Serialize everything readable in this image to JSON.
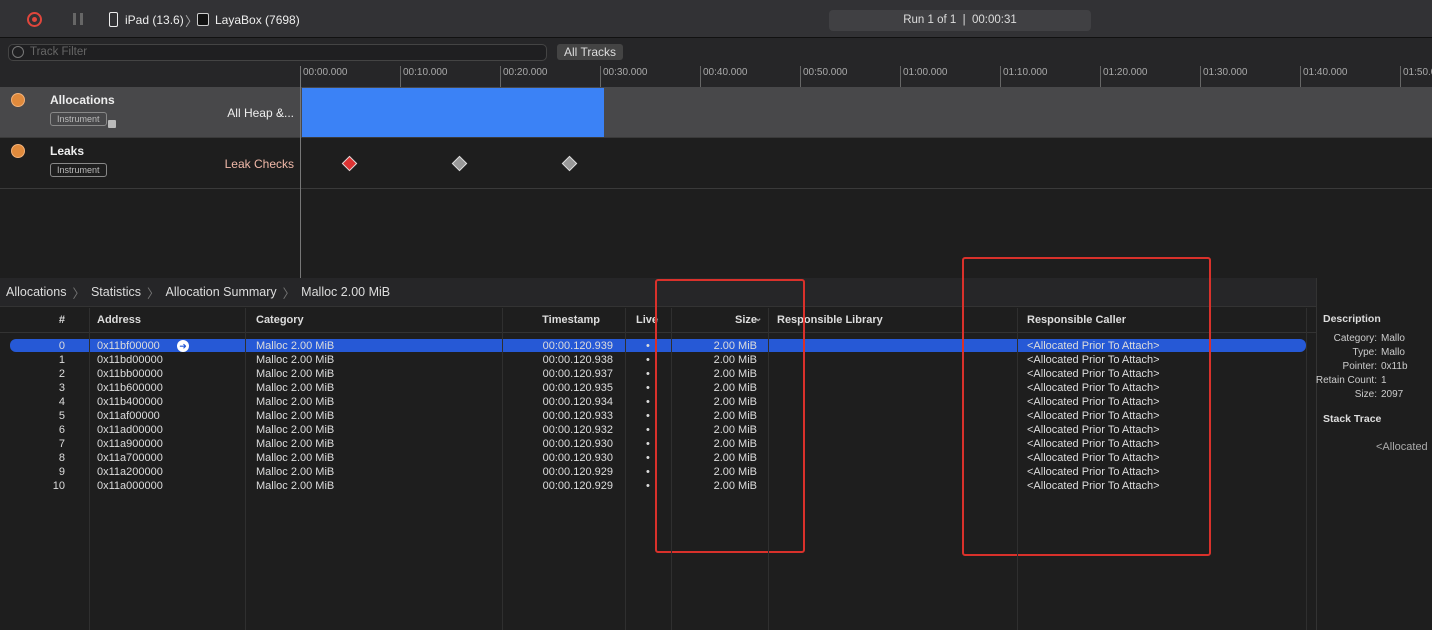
{
  "toolbar": {
    "device": "iPad (13.6)",
    "process": "LayaBox (7698)",
    "run_status": "Run 1 of 1  |  00:00:31"
  },
  "filter": {
    "placeholder": "Track Filter",
    "all_tracks": "All Tracks"
  },
  "ruler": {
    "ticks": [
      "00:00.000",
      "00:10.000",
      "00:20.000",
      "00:30.000",
      "00:40.000",
      "00:50.000",
      "01:00.000",
      "01:10.000",
      "01:20.000",
      "01:30.000",
      "01:40.000",
      "01:50.0"
    ]
  },
  "tracks": [
    {
      "name": "Allocations",
      "badge": "Instrument",
      "subtitle": "All Heap &...",
      "recorded_seconds": 31
    },
    {
      "name": "Leaks",
      "badge": "Instrument",
      "subtitle": "Leak Checks",
      "checks": [
        {
          "t": 5,
          "status": "leak"
        },
        {
          "t": 16,
          "status": "none"
        },
        {
          "t": 27,
          "status": "none"
        }
      ]
    }
  ],
  "breadcrumb": [
    "Allocations",
    "Statistics",
    "Allocation Summary",
    "Malloc 2.00 MiB"
  ],
  "table": {
    "headers": [
      "#",
      "Address",
      "Category",
      "Timestamp",
      "Live",
      "Size",
      "Responsible Library",
      "Responsible Caller"
    ],
    "rows": [
      [
        "0",
        "0x11bf00000",
        "Malloc 2.00 MiB",
        "00:00.120.939",
        "•",
        "2.00 MiB",
        "",
        "<Allocated Prior To Attach>"
      ],
      [
        "1",
        "0x11bd00000",
        "Malloc 2.00 MiB",
        "00:00.120.938",
        "•",
        "2.00 MiB",
        "",
        "<Allocated Prior To Attach>"
      ],
      [
        "2",
        "0x11bb00000",
        "Malloc 2.00 MiB",
        "00:00.120.937",
        "•",
        "2.00 MiB",
        "",
        "<Allocated Prior To Attach>"
      ],
      [
        "3",
        "0x11b600000",
        "Malloc 2.00 MiB",
        "00:00.120.935",
        "•",
        "2.00 MiB",
        "",
        "<Allocated Prior To Attach>"
      ],
      [
        "4",
        "0x11b400000",
        "Malloc 2.00 MiB",
        "00:00.120.934",
        "•",
        "2.00 MiB",
        "",
        "<Allocated Prior To Attach>"
      ],
      [
        "5",
        "0x11af00000",
        "Malloc 2.00 MiB",
        "00:00.120.933",
        "•",
        "2.00 MiB",
        "",
        "<Allocated Prior To Attach>"
      ],
      [
        "6",
        "0x11ad00000",
        "Malloc 2.00 MiB",
        "00:00.120.932",
        "•",
        "2.00 MiB",
        "",
        "<Allocated Prior To Attach>"
      ],
      [
        "7",
        "0x11a900000",
        "Malloc 2.00 MiB",
        "00:00.120.930",
        "•",
        "2.00 MiB",
        "",
        "<Allocated Prior To Attach>"
      ],
      [
        "8",
        "0x11a700000",
        "Malloc 2.00 MiB",
        "00:00.120.930",
        "•",
        "2.00 MiB",
        "",
        "<Allocated Prior To Attach>"
      ],
      [
        "9",
        "0x11a200000",
        "Malloc 2.00 MiB",
        "00:00.120.929",
        "•",
        "2.00 MiB",
        "",
        "<Allocated Prior To Attach>"
      ],
      [
        "10",
        "0x11a000000",
        "Malloc 2.00 MiB",
        "00:00.120.929",
        "•",
        "2.00 MiB",
        "",
        "<Allocated Prior To Attach>"
      ]
    ],
    "selected_row": 0
  },
  "inspector": {
    "description_title": "Description",
    "fields": [
      [
        "Category:",
        "Mallo"
      ],
      [
        "Type:",
        "Mallo"
      ],
      [
        "Pointer:",
        "0x11b"
      ],
      [
        "Retain Count:",
        "1"
      ],
      [
        "Size:",
        "2097"
      ]
    ],
    "stack_title": "Stack Trace",
    "stack_text": "<Allocated"
  },
  "colors": {
    "accent": "#2659d6",
    "track_bar": "#3b82f6",
    "annotation": "#d9312b"
  }
}
